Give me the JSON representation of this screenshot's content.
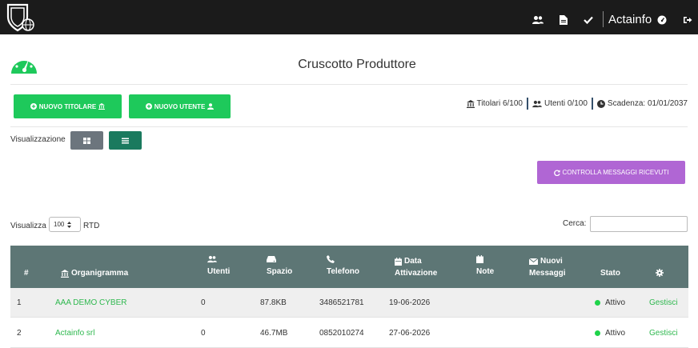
{
  "header": {
    "brand": "Actainfo",
    "nav_icons": [
      "users-icon",
      "document-icon",
      "check-icon",
      "dashboard-icon",
      "logout-icon"
    ]
  },
  "page": {
    "title": "Cruscotto Produttore"
  },
  "actions": {
    "new_holder": "NUOVO TITOLARE",
    "new_user": "NUOVO UTENTE",
    "check_messages": "CONTROLLA MESSAGGI RICEVUTI"
  },
  "stats": {
    "holders": "Titolari 6/100",
    "users": "Utenti 0/100",
    "expiry": "Scadenza: 01/01/2037"
  },
  "view": {
    "label": "Visualizzazione"
  },
  "list_controls": {
    "show_label": "Visualizza",
    "page_size": "100",
    "unit": "RTD",
    "search_label": "Cerca:",
    "search_value": ""
  },
  "table": {
    "headers": {
      "num": "#",
      "org": "Organigramma",
      "users_1": "Utenti",
      "space": "Spazio",
      "phone": "Telefono",
      "date_1": "Data",
      "date_2": "Attivazione",
      "notes": "Note",
      "msgs_1": "Nuovi",
      "msgs_2": "Messaggi",
      "status": "Stato"
    },
    "rows": [
      {
        "num": "1",
        "org": "AAA DEMO CYBER",
        "users": "0",
        "space": "87.8KB",
        "phone": "3486521781",
        "date": "19-06-2026",
        "notes": "",
        "msgs": "",
        "status": "Attivo",
        "action": "Gestisci"
      },
      {
        "num": "2",
        "org": "Actainfo srl",
        "users": "0",
        "space": "46.7MB",
        "phone": "0852010274",
        "date": "27-06-2026",
        "notes": "",
        "msgs": "",
        "status": "Attivo",
        "action": "Gestisci"
      }
    ]
  },
  "colors": {
    "topbar": "#1b1b1b",
    "primary_green": "#1ec95b",
    "purple": "#b066d4",
    "table_header": "#5d7675",
    "view_grid_btn": "#6c757d",
    "view_list_btn": "#1a7a5e",
    "status_active": "#1fd34a",
    "link": "#2fb84f"
  }
}
